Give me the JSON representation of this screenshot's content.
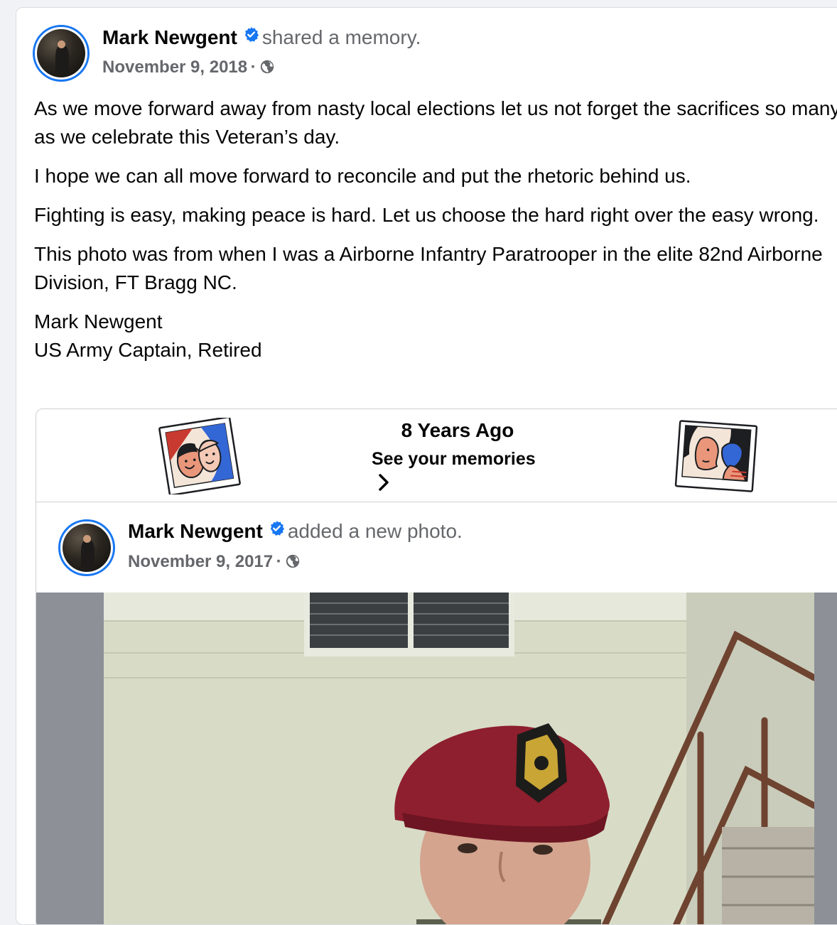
{
  "post": {
    "author": "Mark Newgent",
    "action": "shared a memory.",
    "date": "November 9, 2018",
    "separator": "·",
    "paragraphs": [
      "As we move forward away from nasty local elections let us not forget the sacrifices so many as we celebrate this Veteran’s day.",
      "I hope we can all move forward to reconcile and put the rhetoric behind us.",
      "Fighting is easy, making peace is hard. Let us choose the hard right over the easy wrong.",
      "This photo was from when I was a Airborne Infantry Paratrooper in the elite 82nd Airborne Division, FT Bragg NC."
    ],
    "signature_name": "Mark Newgent",
    "signature_title": "US Army Captain, Retired"
  },
  "memory": {
    "title": "8 Years Ago",
    "subtitle": "See your memories",
    "icons": [
      "friends-photo-illustration",
      "friends-photo-illustration",
      "chevron-right-icon"
    ]
  },
  "inner_post": {
    "author": "Mark Newgent",
    "action": "added a new photo.",
    "date": "November 9, 2017",
    "separator": "·"
  },
  "icons": {
    "verified": "verified-badge-icon",
    "audience": "globe-icon"
  },
  "colors": {
    "accent": "#1877f2",
    "secondary_text": "#65676b",
    "beret": "#8e1f2e"
  }
}
